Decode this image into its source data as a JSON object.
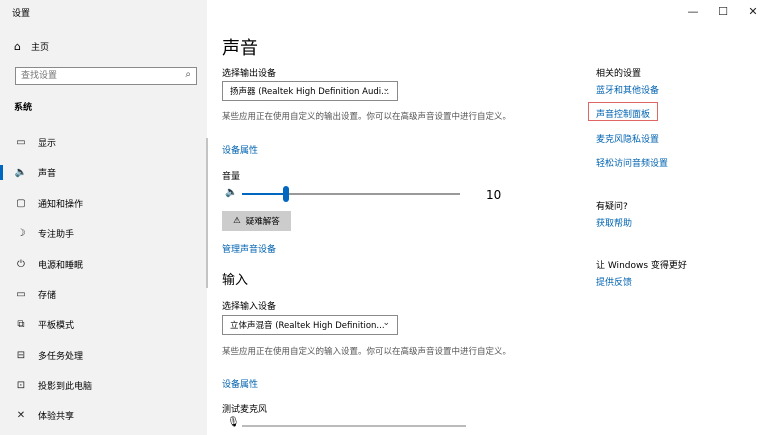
{
  "window": {
    "title": "设置",
    "controls": {
      "minimize": "—",
      "maximize": "☐",
      "close": "✕"
    }
  },
  "sidebar": {
    "home": {
      "icon": "⌂",
      "label": "主页"
    },
    "search": {
      "placeholder": "查找设置",
      "icon": "⌕"
    },
    "section": "系统",
    "items": [
      {
        "icon": "▭",
        "label": "显示",
        "active": false
      },
      {
        "icon": "🔈",
        "label": "声音",
        "active": true
      },
      {
        "icon": "▢",
        "label": "通知和操作",
        "active": false
      },
      {
        "icon": "☽",
        "label": "专注助手",
        "active": false
      },
      {
        "icon": "⏻",
        "label": "电源和睡眠",
        "active": false
      },
      {
        "icon": "▭",
        "label": "存储",
        "active": false
      },
      {
        "icon": "⧉",
        "label": "平板模式",
        "active": false
      },
      {
        "icon": "⊟",
        "label": "多任务处理",
        "active": false
      },
      {
        "icon": "⊡",
        "label": "投影到此电脑",
        "active": false
      },
      {
        "icon": "✕",
        "label": "体验共享",
        "active": false
      }
    ]
  },
  "main": {
    "title": "声音",
    "output": {
      "select_label": "选择输出设备",
      "device": "扬声器 (Realtek High Definition Audi...",
      "description": "某些应用正在使用自定义的输出设置。你可以在高级声音设置中进行自定义。",
      "properties_link": "设备属性",
      "volume_label": "音量",
      "volume_value": "10",
      "volume_fraction": 0.2,
      "troubleshoot_label": "疑难解答",
      "manage_link": "管理声音设备"
    },
    "input": {
      "heading": "输入",
      "select_label": "选择输入设备",
      "device": "立体声混音 (Realtek High Definition...",
      "description": "某些应用正在使用自定义的输入设置。你可以在高级声音设置中进行自定义。",
      "properties_link": "设备属性",
      "test_mic_label": "测试麦克风"
    }
  },
  "related": {
    "heading": "相关的设置",
    "links": [
      "蓝牙和其他设备",
      "声音控制面板",
      "麦克风隐私设置",
      "轻松访问音频设置"
    ],
    "question_heading": "有疑问?",
    "help_link": "获取帮助",
    "improve_heading": "让 Windows 变得更好",
    "feedback_link": "提供反馈"
  }
}
